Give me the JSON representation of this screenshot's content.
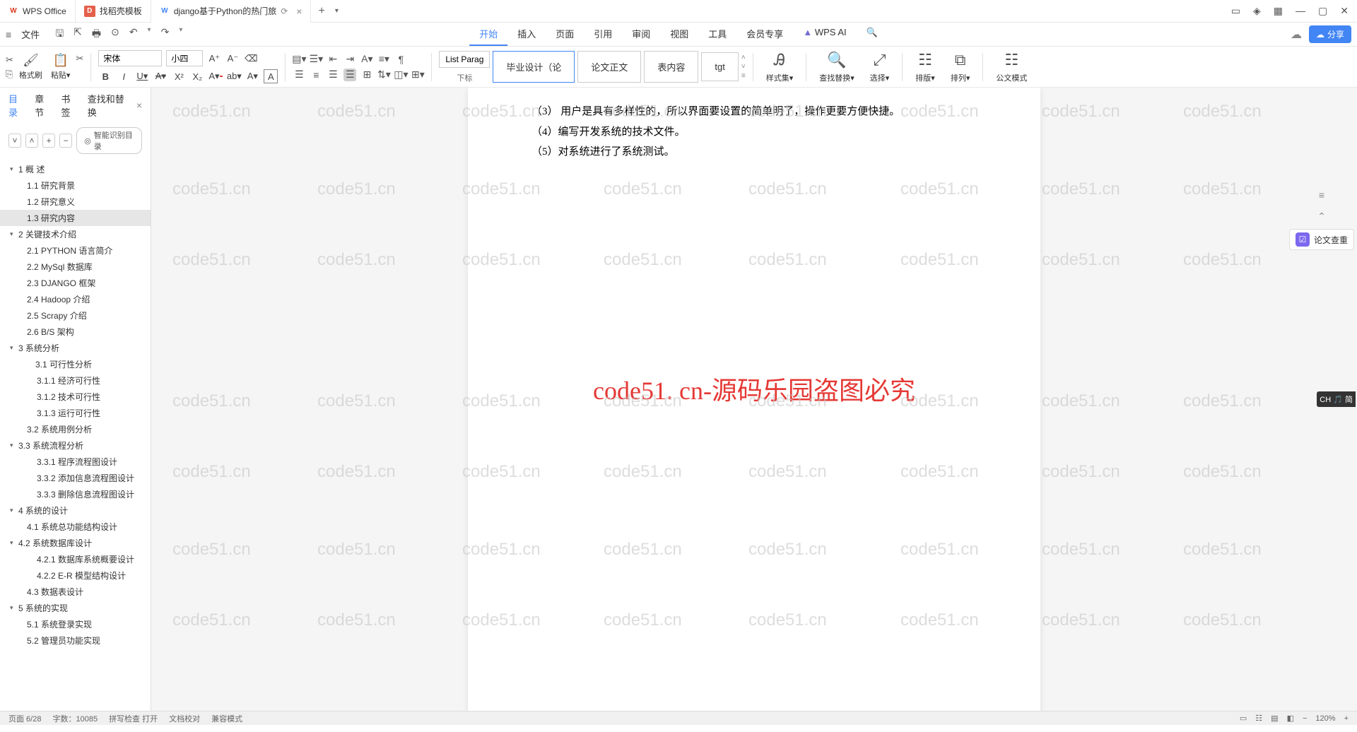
{
  "titlebar": {
    "tabs": [
      {
        "icon": "W",
        "label": "WPS Office"
      },
      {
        "icon": "D",
        "label": "找稻壳模板"
      },
      {
        "icon": "W",
        "label": "django基于Python的热门旅",
        "has_close": true
      }
    ],
    "add": "+",
    "window_controls": [
      "▢",
      "⬡",
      "▦",
      "—",
      "▢",
      "✕"
    ]
  },
  "menubar": {
    "hamburger": "≡",
    "file": "文件",
    "quick_icons": [
      "⎘",
      "⎙",
      "🖨",
      "⟳",
      "↶",
      "↷"
    ],
    "tabs": [
      "开始",
      "插入",
      "页面",
      "引用",
      "审阅",
      "视图",
      "工具",
      "会员专享"
    ],
    "active_tab": "开始",
    "wps_ai": "WPS AI",
    "search": "🔍",
    "cloud": "☁",
    "share": "分享"
  },
  "ribbon": {
    "format_painter": "格式刷",
    "paste": "粘贴",
    "font_name": "宋体",
    "font_size": "小四",
    "style_input": "List Paragrapl",
    "style_sub": "下标",
    "styles": [
      "毕业设计（论",
      "论文正文",
      "表内容",
      "tgt"
    ],
    "big_buttons": {
      "styleset": "样式集",
      "findreplace": "查找替换",
      "select": "选择",
      "layout": "排版",
      "arrange": "排列",
      "govdoc": "公文模式"
    }
  },
  "nav": {
    "tabs": [
      "目录",
      "章节",
      "书签",
      "查找和替换"
    ],
    "active": "目录",
    "ai_toc": "智能识别目录",
    "items": [
      {
        "level": 0,
        "arrow": "▾",
        "text": "1  概    述"
      },
      {
        "level": 1,
        "text": "1.1 研究背景"
      },
      {
        "level": 1,
        "text": "1.2 研究意义"
      },
      {
        "level": 1,
        "text": "1.3 研究内容",
        "selected": true
      },
      {
        "level": 0,
        "arrow": "▾",
        "text": "2  关键技术介绍"
      },
      {
        "level": 1,
        "text": "2.1 PYTHON 语言简介"
      },
      {
        "level": 1,
        "text": "2.2 MySql 数据库"
      },
      {
        "level": 1,
        "text": "2.3 DJANGO 框架"
      },
      {
        "level": 1,
        "text": "2.4 Hadoop 介绍"
      },
      {
        "level": 1,
        "text": "2.5 Scrapy 介绍"
      },
      {
        "level": 1,
        "text": "2.6 B/S 架构"
      },
      {
        "level": 0,
        "arrow": "▾",
        "text": "3  系统分析"
      },
      {
        "level": 1,
        "arrow": "",
        "text": "3.1    可行性分析"
      },
      {
        "level": 2,
        "text": "3.1.1 经济可行性"
      },
      {
        "level": 2,
        "text": "3.1.2 技术可行性"
      },
      {
        "level": 2,
        "text": "3.1.3 运行可行性"
      },
      {
        "level": 1,
        "text": "3.2 系统用例分析"
      },
      {
        "level": 1,
        "arrow": "▾",
        "text": "3.3 系统流程分析",
        "l0arrow": true
      },
      {
        "level": 2,
        "text": "3.3.1 程序流程图设计"
      },
      {
        "level": 2,
        "text": "3.3.2 添加信息流程图设计"
      },
      {
        "level": 2,
        "text": "3.3.3 删除信息流程图设计"
      },
      {
        "level": 0,
        "arrow": "▾",
        "text": "4  系统的设计"
      },
      {
        "level": 1,
        "text": "4.1 系统总功能结构设计"
      },
      {
        "level": 1,
        "arrow": "▾",
        "text": "4.2 系统数据库设计",
        "l0arrow": true
      },
      {
        "level": 2,
        "text": "4.2.1 数据库系统概要设计"
      },
      {
        "level": 2,
        "text": "4.2.2 E-R 模型结构设计"
      },
      {
        "level": 1,
        "text": "4.3 数据表设计"
      },
      {
        "level": 0,
        "arrow": "▾",
        "text": "5  系统的实现"
      },
      {
        "level": 1,
        "text": "5.1 系统登录实现"
      },
      {
        "level": 1,
        "text": "5.2 管理员功能实现"
      }
    ]
  },
  "document": {
    "lines": [
      "（3）  用户是具有多样性的，所以界面要设置的简单明了，操作更要方便快捷。",
      "（4）编写开发系统的技术文件。",
      "（5）对系统进行了系统测试。"
    ],
    "big_watermark": "code51. cn-源码乐园盗图必究",
    "watermark": "code51.cn",
    "doc_check": "论文查重"
  },
  "ime": "CH 🎵 简",
  "statusbar": {
    "left": [
      "页面  6/28",
      "字数：10085",
      "拼写检查  打开",
      "文档校对",
      "兼容模式"
    ],
    "right_zoom": "120%"
  }
}
